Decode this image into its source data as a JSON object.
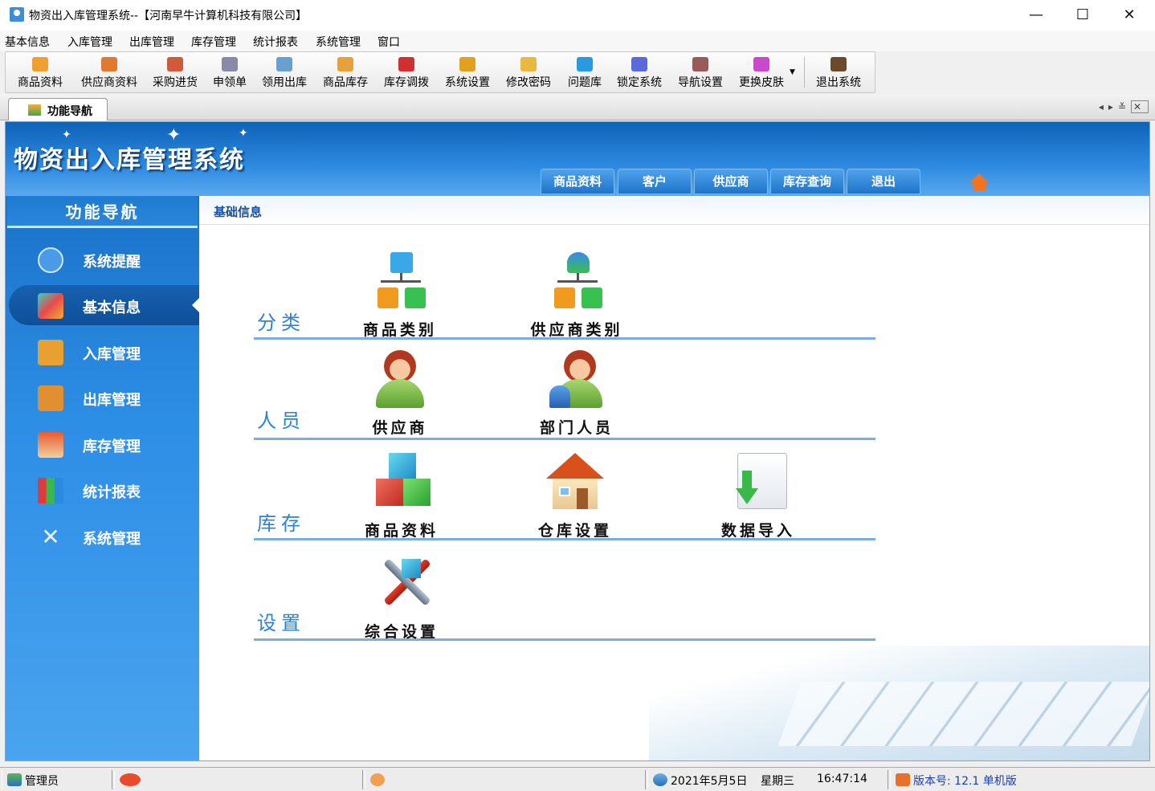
{
  "window": {
    "title": "物资出入库管理系统--【河南早牛计算机科技有限公司】",
    "minimize": "—",
    "maximize": "☐",
    "close": "✕"
  },
  "menu": [
    "基本信息",
    "入库管理",
    "出库管理",
    "库存管理",
    "统计报表",
    "系统管理",
    "窗口"
  ],
  "toolbar": [
    {
      "label": "商品资料",
      "icon": "goods-icon",
      "color": "#f0a030"
    },
    {
      "label": "供应商资料",
      "icon": "supplier-icon",
      "color": "#e07a30"
    },
    {
      "label": "采购进货",
      "icon": "truck-icon",
      "color": "#d05a3a"
    },
    {
      "label": "申领单",
      "icon": "form-icon",
      "color": "#8a8aa8"
    },
    {
      "label": "领用出库",
      "icon": "cart-icon",
      "color": "#6aa0d0"
    },
    {
      "label": "商品库存",
      "icon": "box-icon",
      "color": "#e6a23a"
    },
    {
      "label": "库存调拨",
      "icon": "transfer-icon",
      "color": "#d03030"
    },
    {
      "label": "系统设置",
      "icon": "settings-icon",
      "color": "#e0a020"
    },
    {
      "label": "修改密码",
      "icon": "key-icon",
      "color": "#e8b840"
    },
    {
      "label": "问题库",
      "icon": "help-icon",
      "color": "#2a9ae0"
    },
    {
      "label": "锁定系统",
      "icon": "lock-icon",
      "color": "#5a6ad8"
    },
    {
      "label": "导航设置",
      "icon": "nav-settings-icon",
      "color": "#9a5a5a"
    },
    {
      "label": "更换皮肤",
      "icon": "skin-icon",
      "color": "#c84ac8"
    },
    {
      "label": "退出系统",
      "icon": "exit-icon",
      "color": "#6a4a2a"
    }
  ],
  "tab": {
    "label": "功能导航"
  },
  "banner": {
    "title": "物资出入库管理系统"
  },
  "nav_buttons": [
    "商品资料",
    "客户",
    "供应商",
    "库存查询",
    "退出"
  ],
  "sidebar": {
    "header": "功能导航",
    "items": [
      {
        "label": "系统提醒",
        "icon": "info-icon",
        "color": "#4a9ae8"
      },
      {
        "label": "基本信息",
        "icon": "cubes-icon",
        "color": "#2cb8a0"
      },
      {
        "label": "入库管理",
        "icon": "inbound-box-icon",
        "color": "#e8a030"
      },
      {
        "label": "出库管理",
        "icon": "outbound-box-icon",
        "color": "#e09030"
      },
      {
        "label": "库存管理",
        "icon": "warehouse-icon",
        "color": "#e87a40"
      },
      {
        "label": "统计报表",
        "icon": "bar-chart-icon",
        "color": "#3ab84a"
      },
      {
        "label": "系统管理",
        "icon": "tools-icon",
        "color": "#e0e8f0"
      }
    ]
  },
  "breadcrumb": "基础信息",
  "sections": [
    {
      "label": "分类",
      "items": [
        {
          "label": "商品类别",
          "icon": "category-tree-icon"
        },
        {
          "label": "供应商类别",
          "icon": "supplier-tree-icon"
        }
      ]
    },
    {
      "label": "人员",
      "items": [
        {
          "label": "供应商",
          "icon": "supplier-person-icon"
        },
        {
          "label": "部门人员",
          "icon": "department-staff-icon"
        }
      ]
    },
    {
      "label": "库存",
      "items": [
        {
          "label": "商品资料",
          "icon": "cubes-icon"
        },
        {
          "label": "仓库设置",
          "icon": "house-icon"
        },
        {
          "label": "数据导入",
          "icon": "import-icon"
        }
      ]
    },
    {
      "label": "设置",
      "items": [
        {
          "label": "综合设置",
          "icon": "tools-icon"
        }
      ]
    }
  ],
  "status": {
    "user": "管理员",
    "date": "2021年5月5日",
    "weekday": "星期三",
    "time": "16:47:14",
    "version": "版本号: 12.1 单机版"
  }
}
